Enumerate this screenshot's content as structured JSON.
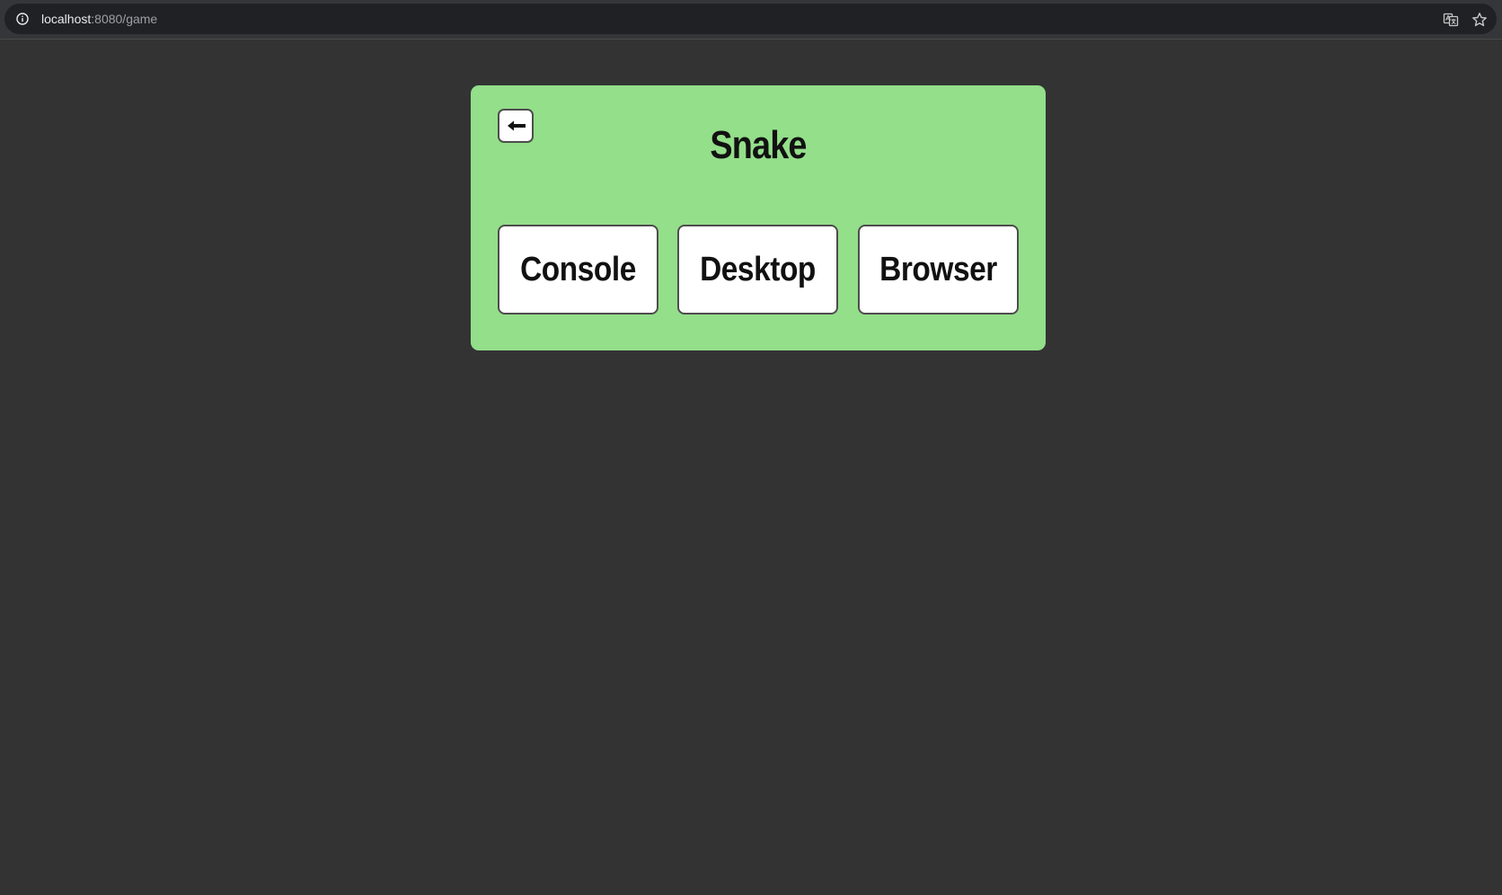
{
  "browser": {
    "url_host": "localhost",
    "url_rest": ":8080/game",
    "icons": [
      "info-icon",
      "translate-icon",
      "star-icon"
    ]
  },
  "panel": {
    "background": "#94df8a",
    "title": "Snake",
    "back_icon": "arrow-left-icon",
    "modes": [
      {
        "label": "Console"
      },
      {
        "label": "Desktop"
      },
      {
        "label": "Browser"
      }
    ]
  }
}
